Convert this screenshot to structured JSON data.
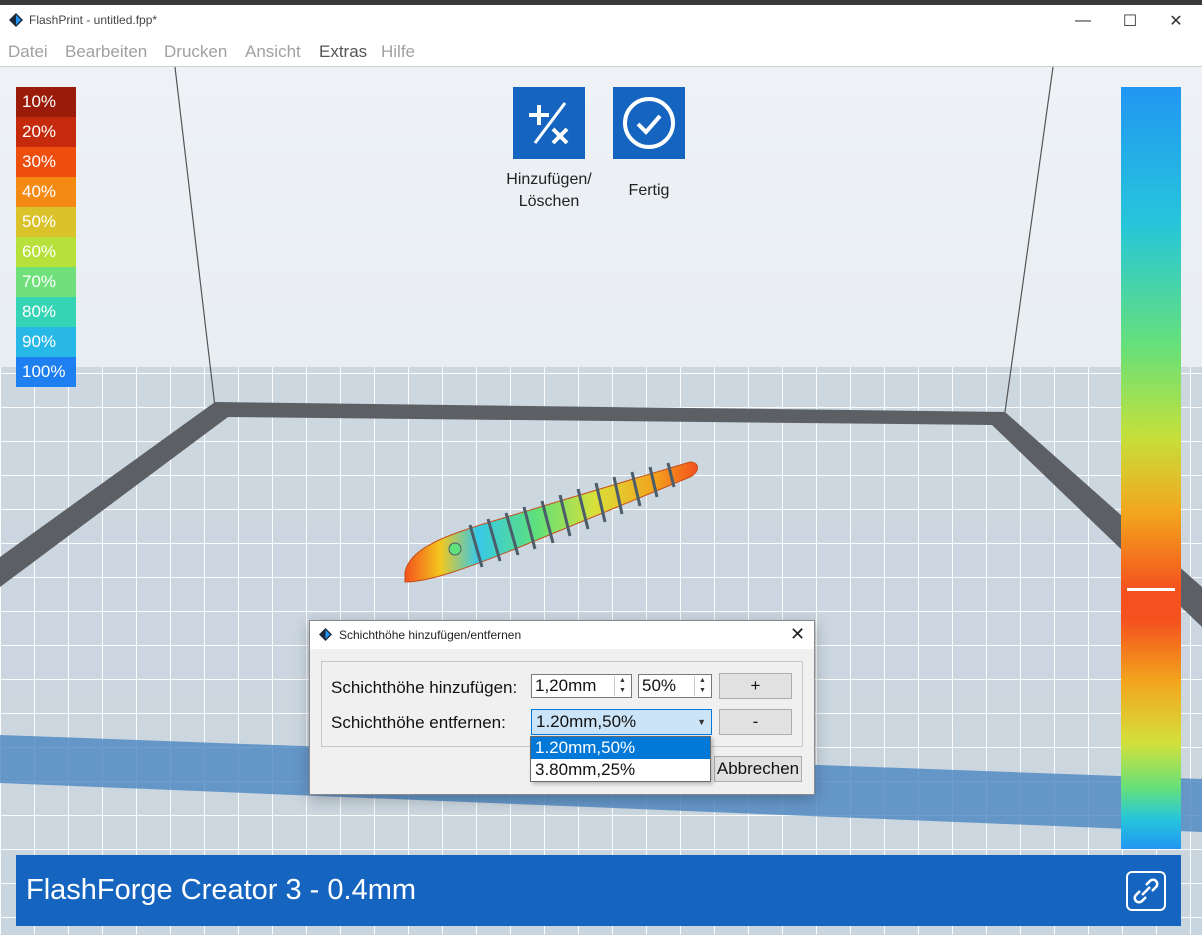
{
  "window": {
    "title": "FlashPrint - untitled.fpp*",
    "minimize_glyph": "—",
    "maximize_glyph": "☐",
    "close_glyph": "✕"
  },
  "menu": {
    "items": [
      {
        "label": "Datei"
      },
      {
        "label": "Bearbeiten"
      },
      {
        "label": "Drucken"
      },
      {
        "label": "Ansicht"
      },
      {
        "label": "Extras"
      },
      {
        "label": "Hilfe"
      }
    ]
  },
  "legend": {
    "items": [
      {
        "label": "10%",
        "color": "#9b1b0a"
      },
      {
        "label": "20%",
        "color": "#c62a0c"
      },
      {
        "label": "30%",
        "color": "#ef4f0e"
      },
      {
        "label": "40%",
        "color": "#f48a14"
      },
      {
        "label": "50%",
        "color": "#d9c22a"
      },
      {
        "label": "60%",
        "color": "#b8e03a"
      },
      {
        "label": "70%",
        "color": "#6fe07a"
      },
      {
        "label": "80%",
        "color": "#35d4b4"
      },
      {
        "label": "90%",
        "color": "#27b8e8"
      },
      {
        "label": "100%",
        "color": "#1e7ff0"
      }
    ]
  },
  "tools": {
    "add_remove_label_line1": "Hinzufügen/",
    "add_remove_label_line2": "Löschen",
    "done_label": "Fertig",
    "accent": "#1565c0"
  },
  "status_bar": {
    "printer": "FlashForge Creator 3 - 0.4mm"
  },
  "dialog": {
    "title": "Schichthöhe hinzufügen/entfernen",
    "add_label": "Schichthöhe hinzufügen:",
    "add_height_value": "1,20mm",
    "add_percent_value": "50%",
    "add_button": "+",
    "remove_label": "Schichthöhe entfernen:",
    "remove_selected": "1.20mm,50%",
    "remove_button": "-",
    "cancel_button": "Abbrechen",
    "close_glyph": "✕",
    "remove_options": [
      {
        "label": "1.20mm,50%",
        "selected": true
      },
      {
        "label": "3.80mm,25%",
        "selected": false
      }
    ]
  }
}
